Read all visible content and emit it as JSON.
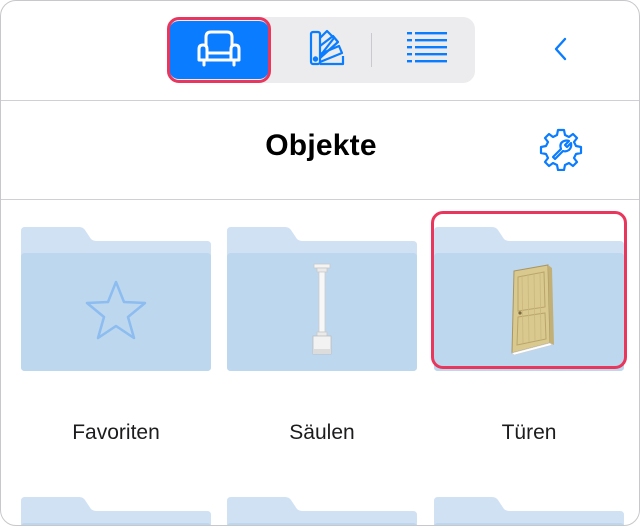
{
  "toolbar": {
    "segments": [
      {
        "icon": "armchair-icon",
        "active": true
      },
      {
        "icon": "swatches-icon",
        "active": false
      },
      {
        "icon": "list-icon",
        "active": false
      }
    ],
    "back_icon": "chevron-left-icon"
  },
  "header": {
    "title": "Objekte",
    "settings_icon": "gear-wrench-icon"
  },
  "folders": [
    {
      "label": "Favoriten",
      "icon": "star-icon"
    },
    {
      "label": "Säulen",
      "icon": "column-icon"
    },
    {
      "label": "Türen",
      "icon": "door-icon",
      "highlighted": true
    }
  ],
  "colors": {
    "accent": "#0a7cff",
    "highlight": "#e8365c",
    "folder_back": "#cfe1f3",
    "folder_front": "#bdd7ee"
  }
}
